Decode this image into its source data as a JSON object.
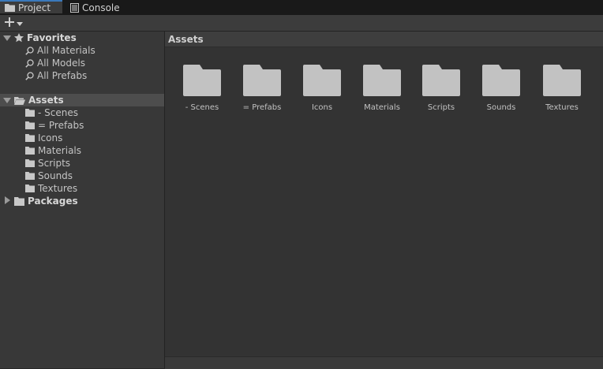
{
  "tabs": [
    {
      "label": "Project",
      "icon": "folder-icon",
      "active": true
    },
    {
      "label": "Console",
      "icon": "console-icon",
      "active": false
    }
  ],
  "toolbar": {
    "add_icon": "plus-icon",
    "dropdown_icon": "chevron-down-icon"
  },
  "favorites": {
    "label": "Favorites",
    "items": [
      {
        "label": "All Materials"
      },
      {
        "label": "All Models"
      },
      {
        "label": "All Prefabs"
      }
    ]
  },
  "assets_tree": {
    "label": "Assets",
    "children": [
      {
        "label": "- Scenes"
      },
      {
        "label": "= Prefabs"
      },
      {
        "label": "Icons"
      },
      {
        "label": "Materials"
      },
      {
        "label": "Scripts"
      },
      {
        "label": "Sounds"
      },
      {
        "label": "Textures"
      }
    ]
  },
  "packages": {
    "label": "Packages"
  },
  "main": {
    "breadcrumb": "Assets",
    "folders": [
      {
        "label": "- Scenes"
      },
      {
        "label": "= Prefabs"
      },
      {
        "label": "Icons"
      },
      {
        "label": "Materials"
      },
      {
        "label": "Scripts"
      },
      {
        "label": "Sounds"
      },
      {
        "label": "Textures"
      }
    ]
  },
  "colors": {
    "selection": "#4d4d4d",
    "accent": "#3a79bb",
    "folder": "#c2c2c2"
  }
}
